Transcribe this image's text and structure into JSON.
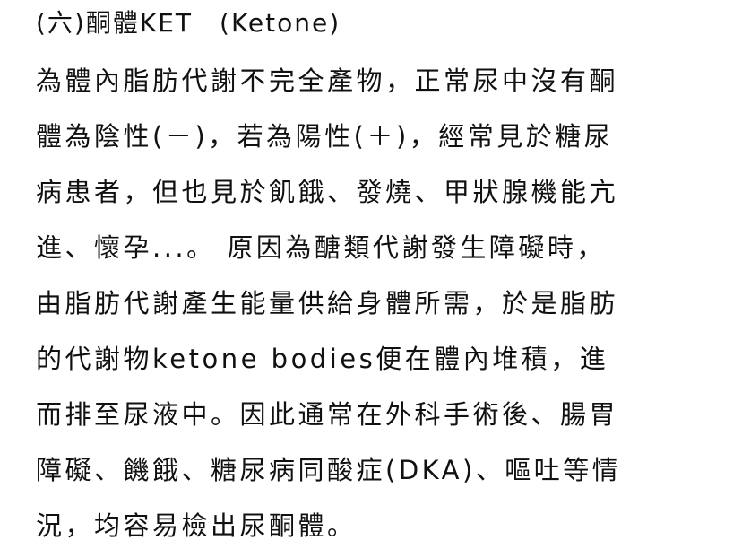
{
  "heading": {
    "part1": "(六)酮體KET",
    "part2": "(Ketone)"
  },
  "paragraph_lines": [
    "為體內脂肪代謝不完全產物，正常尿中沒有酮",
    "體為陰性(－)，若為陽性(＋)，經常見於糖尿",
    "病患者，但也見於飢餓、發燒、甲狀腺機能亢",
    "進、懷孕...。 原因為醣類代謝發生障礙時，",
    "由脂肪代謝產生能量供給身體所需，於是脂肪",
    "的代謝物ketone bodies便在體內堆積，進",
    "而排至尿液中。因此通常在外科手術後、腸胃",
    "障礙、饑餓、糖尿病同酸症(DKA)、嘔吐等情",
    "況，均容易檢出尿酮體。"
  ]
}
